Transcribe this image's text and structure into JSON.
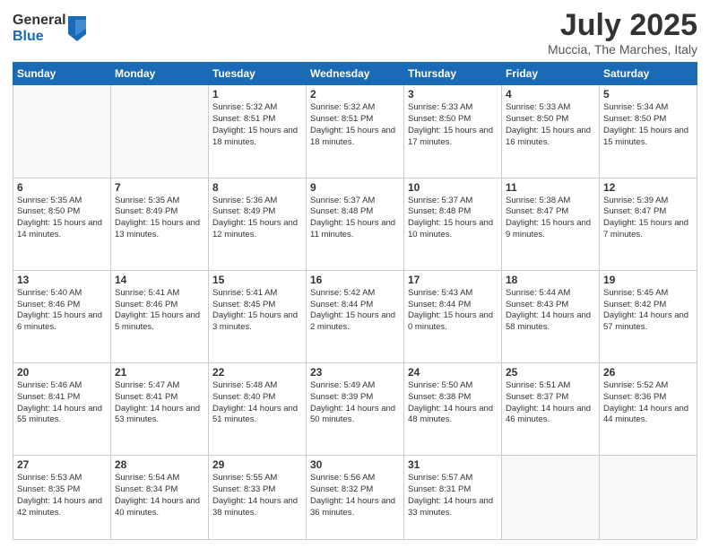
{
  "logo": {
    "general": "General",
    "blue": "Blue"
  },
  "header": {
    "month": "July 2025",
    "location": "Muccia, The Marches, Italy"
  },
  "weekdays": [
    "Sunday",
    "Monday",
    "Tuesday",
    "Wednesday",
    "Thursday",
    "Friday",
    "Saturday"
  ],
  "weeks": [
    [
      {
        "day": "",
        "sunrise": "",
        "sunset": "",
        "daylight": ""
      },
      {
        "day": "",
        "sunrise": "",
        "sunset": "",
        "daylight": ""
      },
      {
        "day": "1",
        "sunrise": "Sunrise: 5:32 AM",
        "sunset": "Sunset: 8:51 PM",
        "daylight": "Daylight: 15 hours and 18 minutes."
      },
      {
        "day": "2",
        "sunrise": "Sunrise: 5:32 AM",
        "sunset": "Sunset: 8:51 PM",
        "daylight": "Daylight: 15 hours and 18 minutes."
      },
      {
        "day": "3",
        "sunrise": "Sunrise: 5:33 AM",
        "sunset": "Sunset: 8:50 PM",
        "daylight": "Daylight: 15 hours and 17 minutes."
      },
      {
        "day": "4",
        "sunrise": "Sunrise: 5:33 AM",
        "sunset": "Sunset: 8:50 PM",
        "daylight": "Daylight: 15 hours and 16 minutes."
      },
      {
        "day": "5",
        "sunrise": "Sunrise: 5:34 AM",
        "sunset": "Sunset: 8:50 PM",
        "daylight": "Daylight: 15 hours and 15 minutes."
      }
    ],
    [
      {
        "day": "6",
        "sunrise": "Sunrise: 5:35 AM",
        "sunset": "Sunset: 8:50 PM",
        "daylight": "Daylight: 15 hours and 14 minutes."
      },
      {
        "day": "7",
        "sunrise": "Sunrise: 5:35 AM",
        "sunset": "Sunset: 8:49 PM",
        "daylight": "Daylight: 15 hours and 13 minutes."
      },
      {
        "day": "8",
        "sunrise": "Sunrise: 5:36 AM",
        "sunset": "Sunset: 8:49 PM",
        "daylight": "Daylight: 15 hours and 12 minutes."
      },
      {
        "day": "9",
        "sunrise": "Sunrise: 5:37 AM",
        "sunset": "Sunset: 8:48 PM",
        "daylight": "Daylight: 15 hours and 11 minutes."
      },
      {
        "day": "10",
        "sunrise": "Sunrise: 5:37 AM",
        "sunset": "Sunset: 8:48 PM",
        "daylight": "Daylight: 15 hours and 10 minutes."
      },
      {
        "day": "11",
        "sunrise": "Sunrise: 5:38 AM",
        "sunset": "Sunset: 8:47 PM",
        "daylight": "Daylight: 15 hours and 9 minutes."
      },
      {
        "day": "12",
        "sunrise": "Sunrise: 5:39 AM",
        "sunset": "Sunset: 8:47 PM",
        "daylight": "Daylight: 15 hours and 7 minutes."
      }
    ],
    [
      {
        "day": "13",
        "sunrise": "Sunrise: 5:40 AM",
        "sunset": "Sunset: 8:46 PM",
        "daylight": "Daylight: 15 hours and 6 minutes."
      },
      {
        "day": "14",
        "sunrise": "Sunrise: 5:41 AM",
        "sunset": "Sunset: 8:46 PM",
        "daylight": "Daylight: 15 hours and 5 minutes."
      },
      {
        "day": "15",
        "sunrise": "Sunrise: 5:41 AM",
        "sunset": "Sunset: 8:45 PM",
        "daylight": "Daylight: 15 hours and 3 minutes."
      },
      {
        "day": "16",
        "sunrise": "Sunrise: 5:42 AM",
        "sunset": "Sunset: 8:44 PM",
        "daylight": "Daylight: 15 hours and 2 minutes."
      },
      {
        "day": "17",
        "sunrise": "Sunrise: 5:43 AM",
        "sunset": "Sunset: 8:44 PM",
        "daylight": "Daylight: 15 hours and 0 minutes."
      },
      {
        "day": "18",
        "sunrise": "Sunrise: 5:44 AM",
        "sunset": "Sunset: 8:43 PM",
        "daylight": "Daylight: 14 hours and 58 minutes."
      },
      {
        "day": "19",
        "sunrise": "Sunrise: 5:45 AM",
        "sunset": "Sunset: 8:42 PM",
        "daylight": "Daylight: 14 hours and 57 minutes."
      }
    ],
    [
      {
        "day": "20",
        "sunrise": "Sunrise: 5:46 AM",
        "sunset": "Sunset: 8:41 PM",
        "daylight": "Daylight: 14 hours and 55 minutes."
      },
      {
        "day": "21",
        "sunrise": "Sunrise: 5:47 AM",
        "sunset": "Sunset: 8:41 PM",
        "daylight": "Daylight: 14 hours and 53 minutes."
      },
      {
        "day": "22",
        "sunrise": "Sunrise: 5:48 AM",
        "sunset": "Sunset: 8:40 PM",
        "daylight": "Daylight: 14 hours and 51 minutes."
      },
      {
        "day": "23",
        "sunrise": "Sunrise: 5:49 AM",
        "sunset": "Sunset: 8:39 PM",
        "daylight": "Daylight: 14 hours and 50 minutes."
      },
      {
        "day": "24",
        "sunrise": "Sunrise: 5:50 AM",
        "sunset": "Sunset: 8:38 PM",
        "daylight": "Daylight: 14 hours and 48 minutes."
      },
      {
        "day": "25",
        "sunrise": "Sunrise: 5:51 AM",
        "sunset": "Sunset: 8:37 PM",
        "daylight": "Daylight: 14 hours and 46 minutes."
      },
      {
        "day": "26",
        "sunrise": "Sunrise: 5:52 AM",
        "sunset": "Sunset: 8:36 PM",
        "daylight": "Daylight: 14 hours and 44 minutes."
      }
    ],
    [
      {
        "day": "27",
        "sunrise": "Sunrise: 5:53 AM",
        "sunset": "Sunset: 8:35 PM",
        "daylight": "Daylight: 14 hours and 42 minutes."
      },
      {
        "day": "28",
        "sunrise": "Sunrise: 5:54 AM",
        "sunset": "Sunset: 8:34 PM",
        "daylight": "Daylight: 14 hours and 40 minutes."
      },
      {
        "day": "29",
        "sunrise": "Sunrise: 5:55 AM",
        "sunset": "Sunset: 8:33 PM",
        "daylight": "Daylight: 14 hours and 38 minutes."
      },
      {
        "day": "30",
        "sunrise": "Sunrise: 5:56 AM",
        "sunset": "Sunset: 8:32 PM",
        "daylight": "Daylight: 14 hours and 36 minutes."
      },
      {
        "day": "31",
        "sunrise": "Sunrise: 5:57 AM",
        "sunset": "Sunset: 8:31 PM",
        "daylight": "Daylight: 14 hours and 33 minutes."
      },
      {
        "day": "",
        "sunrise": "",
        "sunset": "",
        "daylight": ""
      },
      {
        "day": "",
        "sunrise": "",
        "sunset": "",
        "daylight": ""
      }
    ]
  ]
}
